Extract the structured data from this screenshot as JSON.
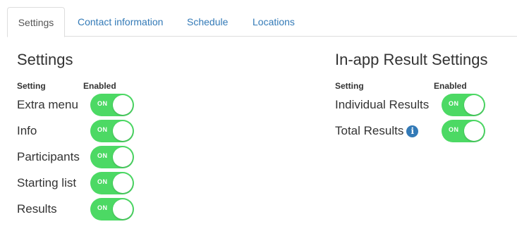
{
  "tabs": [
    {
      "label": "Settings",
      "active": true
    },
    {
      "label": "Contact information",
      "active": false
    },
    {
      "label": "Schedule",
      "active": false
    },
    {
      "label": "Locations",
      "active": false
    }
  ],
  "settings": {
    "title": "Settings",
    "col_setting": "Setting",
    "col_enabled": "Enabled",
    "rows": [
      {
        "label": "Extra menu",
        "toggle_text": "ON",
        "enabled": true
      },
      {
        "label": "Info",
        "toggle_text": "ON",
        "enabled": true
      },
      {
        "label": "Participants",
        "toggle_text": "ON",
        "enabled": true
      },
      {
        "label": "Starting list",
        "toggle_text": "ON",
        "enabled": true
      },
      {
        "label": "Results",
        "toggle_text": "ON",
        "enabled": true
      }
    ]
  },
  "result_settings": {
    "title": "In-app Result Settings",
    "col_setting": "Setting",
    "col_enabled": "Enabled",
    "rows": [
      {
        "label": "Individual Results",
        "toggle_text": "ON",
        "enabled": true
      },
      {
        "label": "Total Results",
        "toggle_text": "ON",
        "enabled": true,
        "info_icon": "info-icon",
        "info_glyph": "i"
      }
    ]
  },
  "colors": {
    "toggle_on": "#4cd964",
    "link": "#337ab7",
    "text": "#333333"
  }
}
